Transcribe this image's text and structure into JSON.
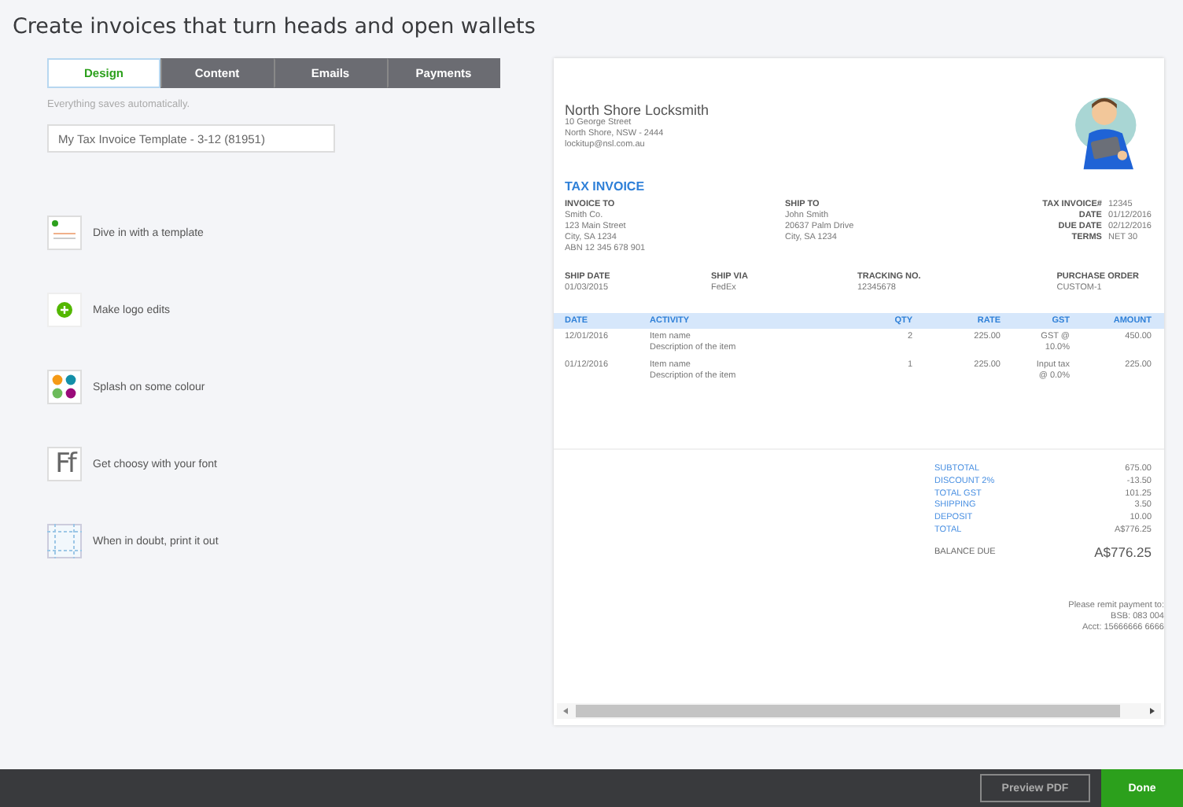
{
  "title": "Create invoices that turn heads and open wallets",
  "tabs": [
    {
      "label": "Design",
      "selected": true
    },
    {
      "label": "Content",
      "selected": false
    },
    {
      "label": "Emails",
      "selected": false
    },
    {
      "label": "Payments",
      "selected": false
    }
  ],
  "autosave_note": "Everything saves automatically.",
  "template_name": "My Tax Invoice Template - 3-12 (81951)",
  "design_options": [
    {
      "kind": "template",
      "label": "Dive in with a template"
    },
    {
      "kind": "logo",
      "label": "Make logo edits"
    },
    {
      "kind": "colour",
      "label": "Splash on some colour"
    },
    {
      "kind": "font",
      "label": "Get choosy with your font",
      "icon_text": "Ff"
    },
    {
      "kind": "print",
      "label": "When in doubt, print it out"
    }
  ],
  "invoice": {
    "company": {
      "name": "North Shore Locksmith",
      "lines": [
        "10 George Street",
        "North Shore, NSW - 2444",
        "lockitup@nsl.com.au"
      ]
    },
    "heading": "TAX INVOICE",
    "invoice_to": {
      "heading": "INVOICE TO",
      "lines": [
        "Smith Co.",
        "123 Main Street",
        "City, SA 1234",
        "ABN 12 345 678 901"
      ]
    },
    "ship_to": {
      "heading": "SHIP TO",
      "lines": [
        "John Smith",
        "20637 Palm Drive",
        "City, SA 1234"
      ]
    },
    "meta": [
      {
        "label": "TAX INVOICE#",
        "value": "12345"
      },
      {
        "label": "DATE",
        "value": "01/12/2016"
      },
      {
        "label": "DUE DATE",
        "value": "02/12/2016"
      },
      {
        "label": "TERMS",
        "value": "NET 30"
      }
    ],
    "shipping": [
      {
        "label": "SHIP DATE",
        "value": "01/03/2015"
      },
      {
        "label": "SHIP VIA",
        "value": "FedEx"
      },
      {
        "label": "TRACKING NO.",
        "value": "12345678"
      },
      {
        "label": "PURCHASE ORDER",
        "value": "CUSTOM-1"
      }
    ],
    "columns": [
      "DATE",
      "ACTIVITY",
      "QTY",
      "RATE",
      "GST",
      "AMOUNT"
    ],
    "rows": [
      {
        "date": "12/01/2016",
        "activity": "Item name",
        "description": "Description of the item",
        "qty": "2",
        "rate": "225.00",
        "gst": "GST @\n10.0%",
        "amount": "450.00"
      },
      {
        "date": "01/12/2016",
        "activity": "Item name",
        "description": "Description of the item",
        "qty": "1",
        "rate": "225.00",
        "gst": "Input tax\n@ 0.0%",
        "amount": "225.00"
      }
    ],
    "totals": [
      {
        "label": "SUBTOTAL",
        "value": "675.00"
      },
      {
        "label": "DISCOUNT 2%",
        "value": "-13.50"
      },
      {
        "label": "TOTAL GST",
        "value": "101.25"
      },
      {
        "label": "SHIPPING",
        "value": "3.50"
      },
      {
        "label": "DEPOSIT",
        "value": "10.00"
      },
      {
        "label": "TOTAL",
        "value": "A$776.25"
      }
    ],
    "balance": {
      "label": "BALANCE DUE",
      "value": "A$776.25"
    },
    "remit": [
      "Please remit payment to:",
      "BSB: 083 004",
      "Acct: 15666666 6666"
    ]
  },
  "footer_buttons": [
    {
      "kind": "secondary",
      "label": "Preview PDF"
    },
    {
      "kind": "primary",
      "label": "Done"
    }
  ]
}
